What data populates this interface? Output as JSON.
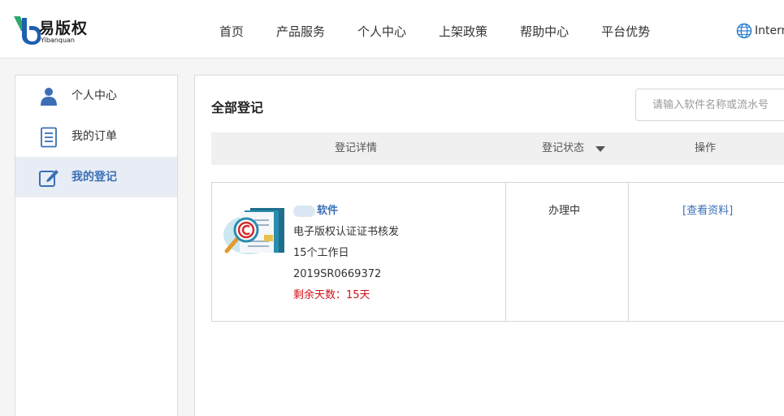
{
  "header": {
    "logo_text": "易版权",
    "logo_sub": "Yibanquan",
    "nav": [
      {
        "label": "首页"
      },
      {
        "label": "产品服务"
      },
      {
        "label": "个人中心"
      },
      {
        "label": "上架政策"
      },
      {
        "label": "帮助中心"
      },
      {
        "label": "平台优势"
      }
    ],
    "lang_label": "Intern"
  },
  "sidebar": {
    "items": [
      {
        "label": "个人中心",
        "icon": "user-icon"
      },
      {
        "label": "我的订单",
        "icon": "document-icon"
      },
      {
        "label": "我的登记",
        "icon": "edit-icon",
        "active": true
      }
    ]
  },
  "main": {
    "title": "全部登记",
    "search_placeholder": "请输入软件名称或流水号",
    "columns": {
      "detail": "登记详情",
      "status": "登记状态",
      "operation": "操作"
    },
    "rows": [
      {
        "name": "软件",
        "type": "电子版权认证证书核发",
        "duration": "15个工作日",
        "serial": "2019SR0669372",
        "remaining": "剩余天数：15天",
        "status": "办理中",
        "action": "[查看资料]"
      }
    ]
  },
  "colors": {
    "accent": "#3a6fb5",
    "remaining": "#d0121b",
    "active_bg": "#e8edf5"
  }
}
